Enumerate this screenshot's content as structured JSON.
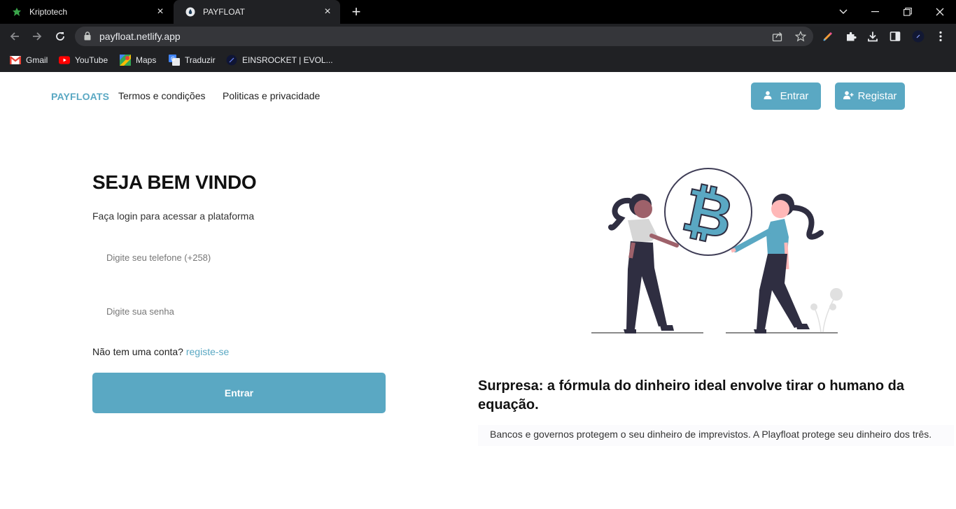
{
  "browser": {
    "tabs": [
      {
        "title": "Kriptotech",
        "active": false,
        "icon": "leaf-icon"
      },
      {
        "title": "PAYFLOAT",
        "active": true,
        "icon": "drop-icon"
      }
    ],
    "url": "payfloat.netlify.app",
    "bookmarks": [
      {
        "label": "Gmail",
        "icon": "gmail-icon"
      },
      {
        "label": "YouTube",
        "icon": "youtube-icon"
      },
      {
        "label": "Maps",
        "icon": "maps-icon"
      },
      {
        "label": "Traduzir",
        "icon": "translate-icon"
      },
      {
        "label": "EINSROCKET | EVOL...",
        "icon": "rocket-icon"
      }
    ]
  },
  "nav": {
    "brand": "PAYFLOATS",
    "links": [
      "Termos e condições",
      "Politicas e privacidade"
    ],
    "login_label": "Entrar",
    "register_label": "Registar"
  },
  "login": {
    "title": "SEJA BEM VINDO",
    "subtitle": "Faça login para acessar a plataforma",
    "phone_placeholder": "Digite seu telefone (+258)",
    "password_placeholder": "Digite sua senha",
    "no_account_text": "Não tem uma conta?",
    "register_link": "registe-se",
    "submit_label": "Entrar"
  },
  "promo": {
    "headline": "Surpresa: a fórmula do dinheiro ideal envolve tirar o humano da equação.",
    "description": "Bancos e governos protegem o seu dinheiro de imprevistos. A Playfloat protege seu dinheiro dos três."
  },
  "colors": {
    "accent": "#5aa8c3",
    "chrome_dark": "#202124"
  }
}
